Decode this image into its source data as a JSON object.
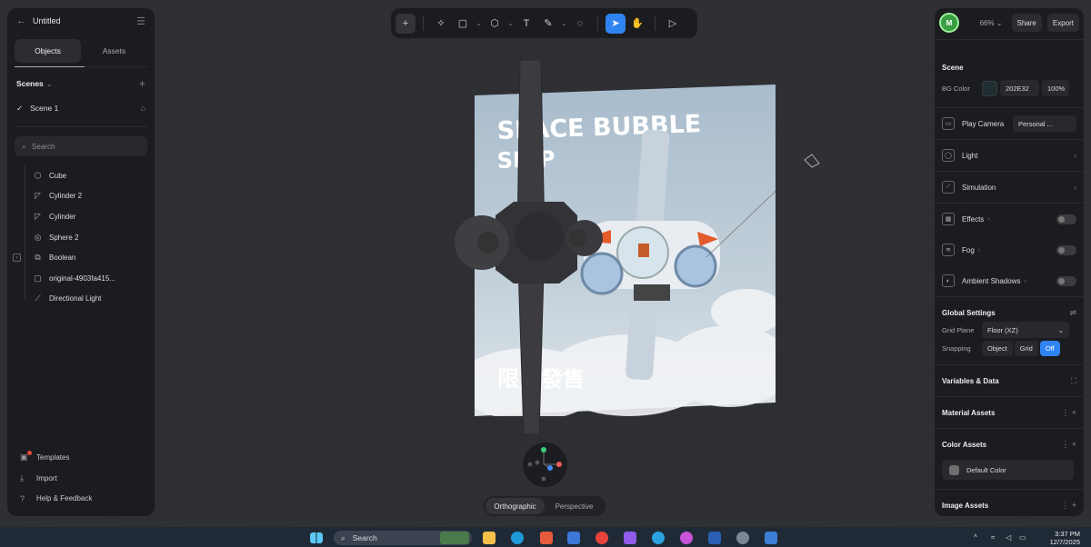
{
  "left_panel": {
    "title": "Untitled",
    "tabs": [
      "Objects",
      "Assets"
    ],
    "scenes_label": "Scenes",
    "scene_item": "Scene 1",
    "search_placeholder": "Search",
    "objects": [
      {
        "label": "Cube",
        "icon": "cube-icon"
      },
      {
        "label": "Cylinder 2",
        "icon": "cylinder-icon"
      },
      {
        "label": "Cylinder",
        "icon": "cylinder-icon"
      },
      {
        "label": "Sphere 2",
        "icon": "sphere-icon"
      },
      {
        "label": "Boolean",
        "icon": "boolean-icon"
      },
      {
        "label": "original-4903fa415...",
        "icon": "image-plane-icon"
      },
      {
        "label": "Directional Light",
        "icon": "light-icon"
      }
    ],
    "footer": [
      "Templates",
      "Import",
      "Help & Feedback"
    ]
  },
  "toolbar": {
    "tools": [
      "add",
      "ai-sparkle",
      "shape",
      "object",
      "text",
      "pen",
      "comment",
      "select",
      "hand",
      "play"
    ],
    "active_tool": "select"
  },
  "right_panel": {
    "avatar_letter": "M",
    "zoom": "66%",
    "share_label": "Share",
    "export_label": "Export",
    "scene_title": "Scene",
    "bg_color_label": "BG Color",
    "bg_color_value": "202E32",
    "bg_opacity": "100%",
    "play_camera_label": "Play Camera",
    "play_camera_value": "Personal ...",
    "light_label": "Light",
    "simulation_label": "Simulation",
    "effects_label": "Effects",
    "fog_label": "Fog",
    "ambient_shadows_label": "Ambient Shadows",
    "global_settings_label": "Global Settings",
    "grid_plane_label": "Grid Plane",
    "grid_plane_value": "Floor (XZ)",
    "snapping_label": "Snapping",
    "snapping_options": [
      "Object",
      "Grid",
      "Off"
    ],
    "snapping_active": "Off",
    "variables_label": "Variables & Data",
    "material_assets_label": "Material Assets",
    "color_assets_label": "Color Assets",
    "default_color_label": "Default Color",
    "image_assets_label": "Image Assets"
  },
  "viewport": {
    "poster_title_line1": "SPACE BUBBLE",
    "poster_title_line2": "SHIP",
    "poster_cjk": "限定發售",
    "view_modes": [
      "Orthographic",
      "Perspective"
    ],
    "active_view": "Orthographic"
  },
  "taskbar": {
    "search_label": "Search",
    "time": "3:37 PM",
    "date": "12/7/2025"
  },
  "colors": {
    "accent": "#2f84f1",
    "bg": "#2e2f33",
    "panel": "#1b1c1f",
    "bg_color_swatch": "#202e32"
  }
}
